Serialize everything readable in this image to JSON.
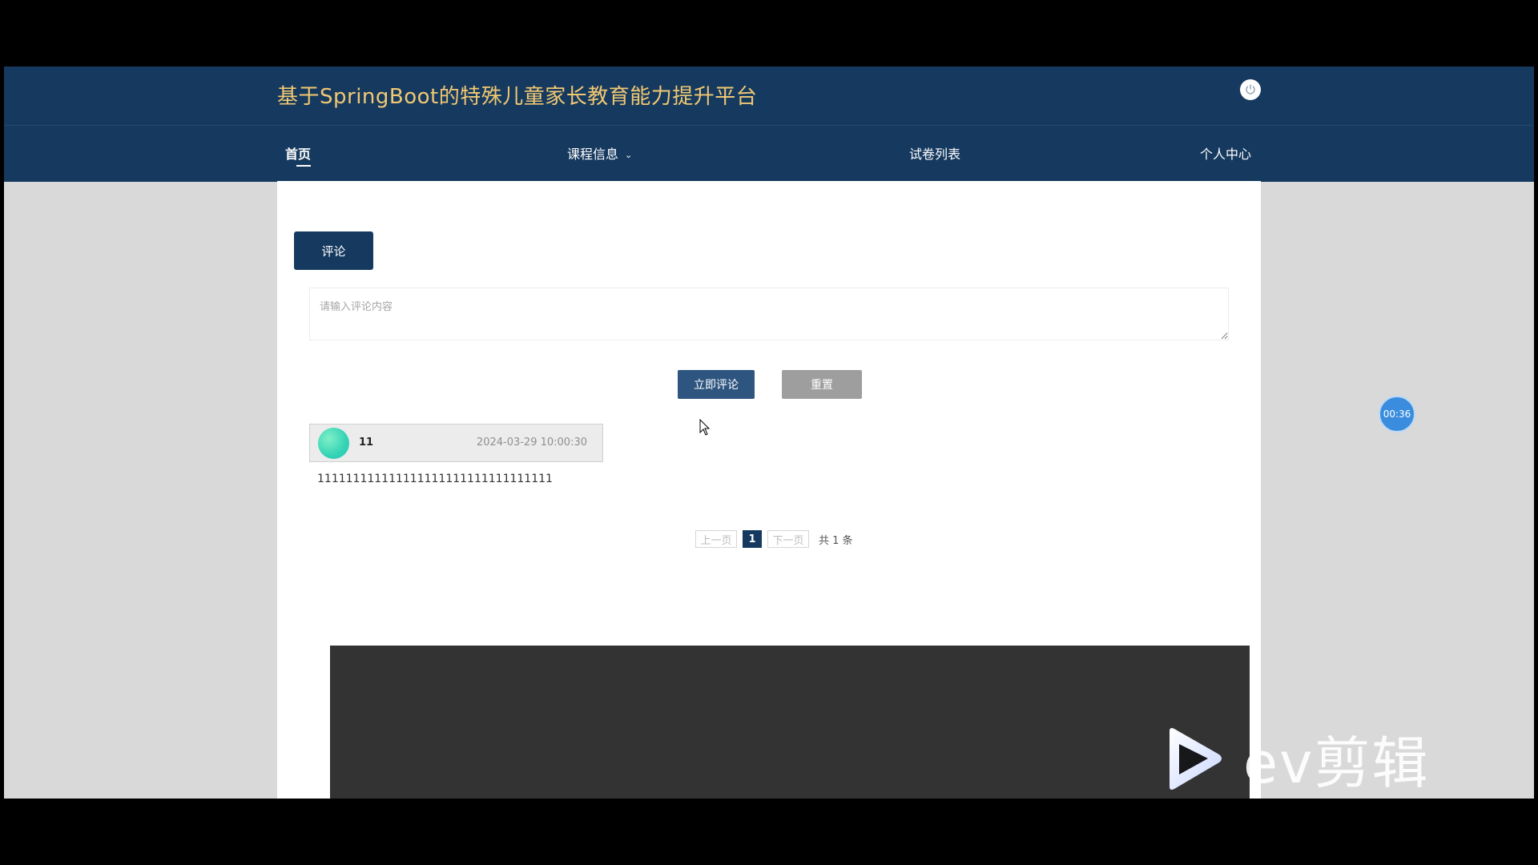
{
  "header": {
    "site_title": "基于SpringBoot的特殊儿童家长教育能力提升平台",
    "power_icon": "power-icon"
  },
  "nav": {
    "items": [
      {
        "label": "首页",
        "active": true
      },
      {
        "label": "课程信息",
        "has_dropdown": true
      },
      {
        "label": "试卷列表"
      },
      {
        "label": "个人中心"
      }
    ]
  },
  "comments_section": {
    "tab_label": "评论",
    "input_placeholder": "请输入评论内容",
    "input_value": "",
    "submit_label": "立即评论",
    "reset_label": "重置",
    "comments": [
      {
        "user": "11",
        "time": "2024-03-29 10:00:30",
        "text": "111111111111111111111111111111111"
      }
    ]
  },
  "pagination": {
    "prev_label": "上一页",
    "current_page": "1",
    "next_label": "下一页",
    "total_label": "共 1 条"
  },
  "overlay": {
    "timer": "00:36",
    "watermark": "ev剪辑"
  },
  "colors": {
    "header_bg": "#163a5f",
    "title_color": "#f1c872",
    "page_bg": "#d9d9d9",
    "video_bg": "#333333"
  }
}
